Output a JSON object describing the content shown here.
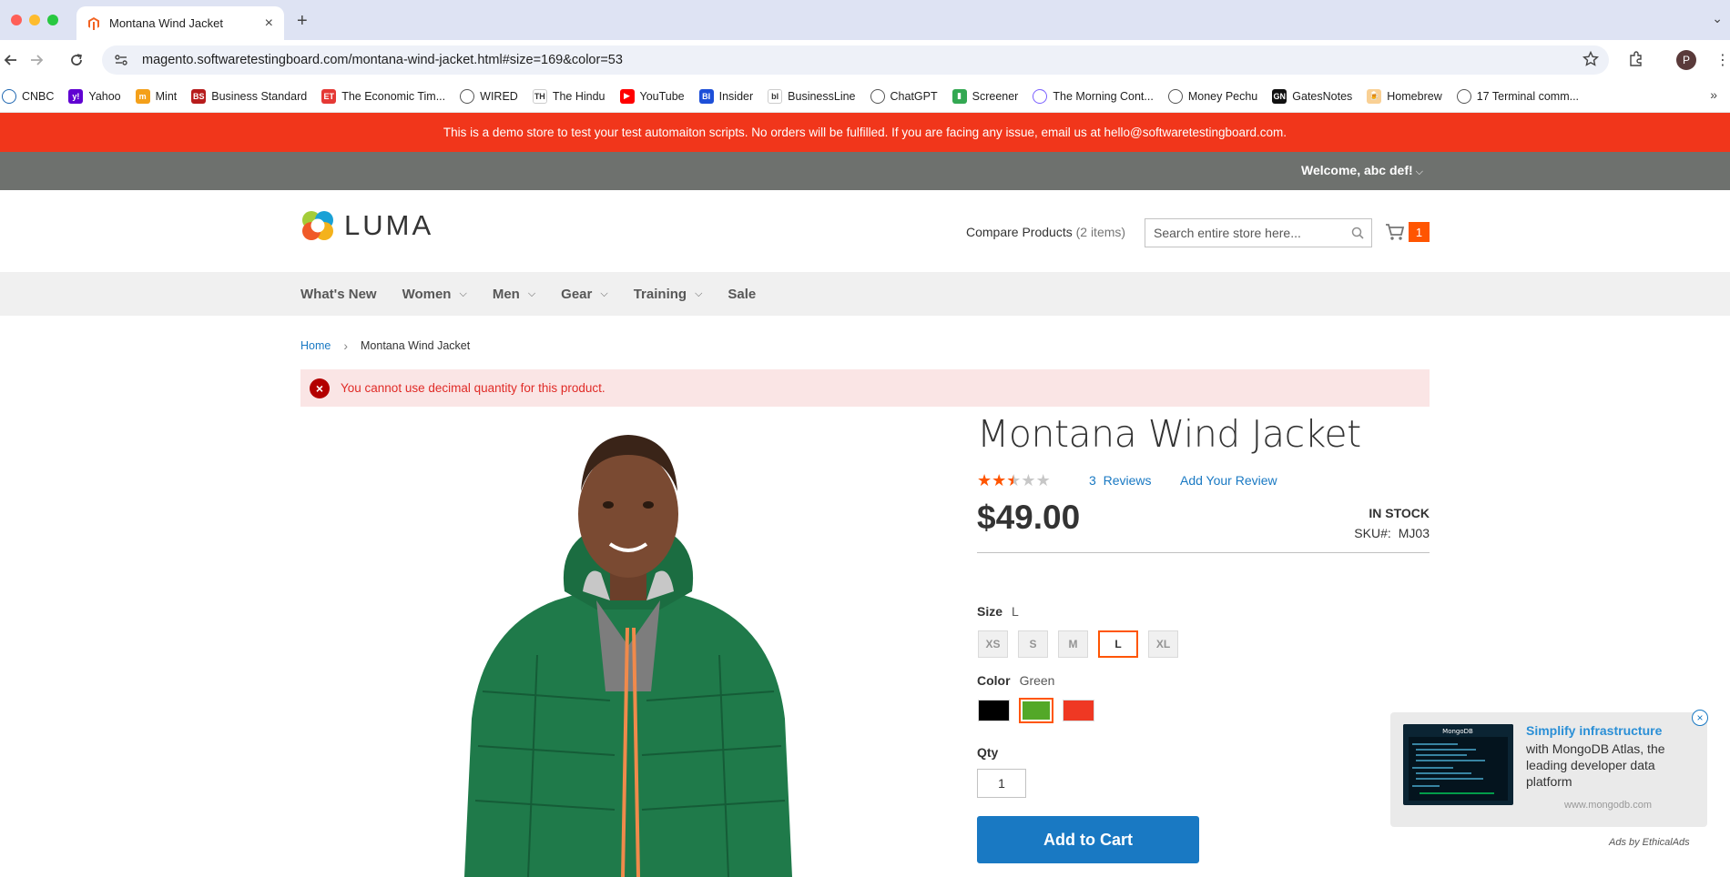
{
  "browser": {
    "tab_title": "Montana Wind Jacket",
    "url": "magento.softwaretestingboard.com/montana-wind-jacket.html#size=169&color=53",
    "profile_initial": "P",
    "bookmarks": [
      {
        "label": "CNBC",
        "icon_color": "#1f67b1",
        "icon_text": ""
      },
      {
        "label": "Yahoo",
        "icon_color": "#6001d2",
        "icon_text": "y!"
      },
      {
        "label": "Mint",
        "icon_color": "#f4a01a",
        "icon_text": "m"
      },
      {
        "label": "Business Standard",
        "icon_color": "#b71c1c",
        "icon_text": "BS"
      },
      {
        "label": "The Economic Tim...",
        "icon_color": "#e53935",
        "icon_text": "ET"
      },
      {
        "label": "WIRED",
        "icon_color": "#555555",
        "icon_text": ""
      },
      {
        "label": "The Hindu",
        "icon_color": "#ffffff",
        "icon_text": "TH"
      },
      {
        "label": "YouTube",
        "icon_color": "#ff0000",
        "icon_text": "▶"
      },
      {
        "label": "Insider",
        "icon_color": "#1d4fd8",
        "icon_text": "BI"
      },
      {
        "label": "BusinessLine",
        "icon_color": "#ffffff",
        "icon_text": "bl"
      },
      {
        "label": "ChatGPT",
        "icon_color": "#555555",
        "icon_text": ""
      },
      {
        "label": "Screener",
        "icon_color": "#33a852",
        "icon_text": "▮"
      },
      {
        "label": "The Morning Cont...",
        "icon_color": "#7b61ff",
        "icon_text": ""
      },
      {
        "label": "Money Pechu",
        "icon_color": "#555555",
        "icon_text": ""
      },
      {
        "label": "GatesNotes",
        "icon_color": "#111111",
        "icon_text": "GN"
      },
      {
        "label": "Homebrew",
        "icon_color": "#f9d094",
        "icon_text": "🍺"
      },
      {
        "label": "17 Terminal comm...",
        "icon_color": "#555555",
        "icon_text": ""
      }
    ]
  },
  "store": {
    "demo_banner": "This is a demo store to test your test automaiton scripts. No orders will be fulfilled. If you are facing any issue, email us at hello@softwaretestingboard.com.",
    "welcome": "Welcome, abc def!",
    "logo_text": "LUMA",
    "compare_label": "Compare Products",
    "compare_count": "(2 items)",
    "search_placeholder": "Search entire store here...",
    "cart_count": "1",
    "nav": [
      {
        "label": "What's New",
        "has_caret": false
      },
      {
        "label": "Women",
        "has_caret": true
      },
      {
        "label": "Men",
        "has_caret": true
      },
      {
        "label": "Gear",
        "has_caret": true
      },
      {
        "label": "Training",
        "has_caret": true
      },
      {
        "label": "Sale",
        "has_caret": false
      }
    ],
    "breadcrumb": {
      "home": "Home",
      "separator": "›",
      "current": "Montana Wind Jacket"
    },
    "error_message": "You cannot use decimal quantity for this product."
  },
  "product": {
    "name": "Montana Wind Jacket",
    "rating_stars": 2.5,
    "rating_max": 5,
    "reviews_count": "3",
    "reviews_label": "Reviews",
    "add_review_label": "Add Your Review",
    "price": "$49.00",
    "stock": "IN STOCK",
    "sku_label": "SKU#:",
    "sku": "MJ03",
    "size_label": "Size",
    "size_selected": "L",
    "sizes": [
      "XS",
      "S",
      "M",
      "L",
      "XL"
    ],
    "color_label": "Color",
    "color_selected": "Green",
    "colors": [
      {
        "name": "Black",
        "hex": "#000000",
        "selected": false
      },
      {
        "name": "Green",
        "hex": "#53a828",
        "selected": true
      },
      {
        "name": "Red",
        "hex": "#ef3823",
        "selected": false
      }
    ],
    "qty_label": "Qty",
    "qty_value": "1",
    "add_to_cart_label": "Add to Cart"
  },
  "ad": {
    "headline": "Simplify infrastructure",
    "body": "with MongoDB Atlas, the leading developer data platform",
    "url": "www.mongodb.com",
    "attribution": "Ads by EthicalAds",
    "thumb_brand": "MongoDB",
    "close_glyph": "×"
  },
  "colors": {
    "banner_red": "#f1361b",
    "link_blue": "#1979c3",
    "accent_orange": "#ff5501",
    "star_orange": "#ff5501"
  }
}
